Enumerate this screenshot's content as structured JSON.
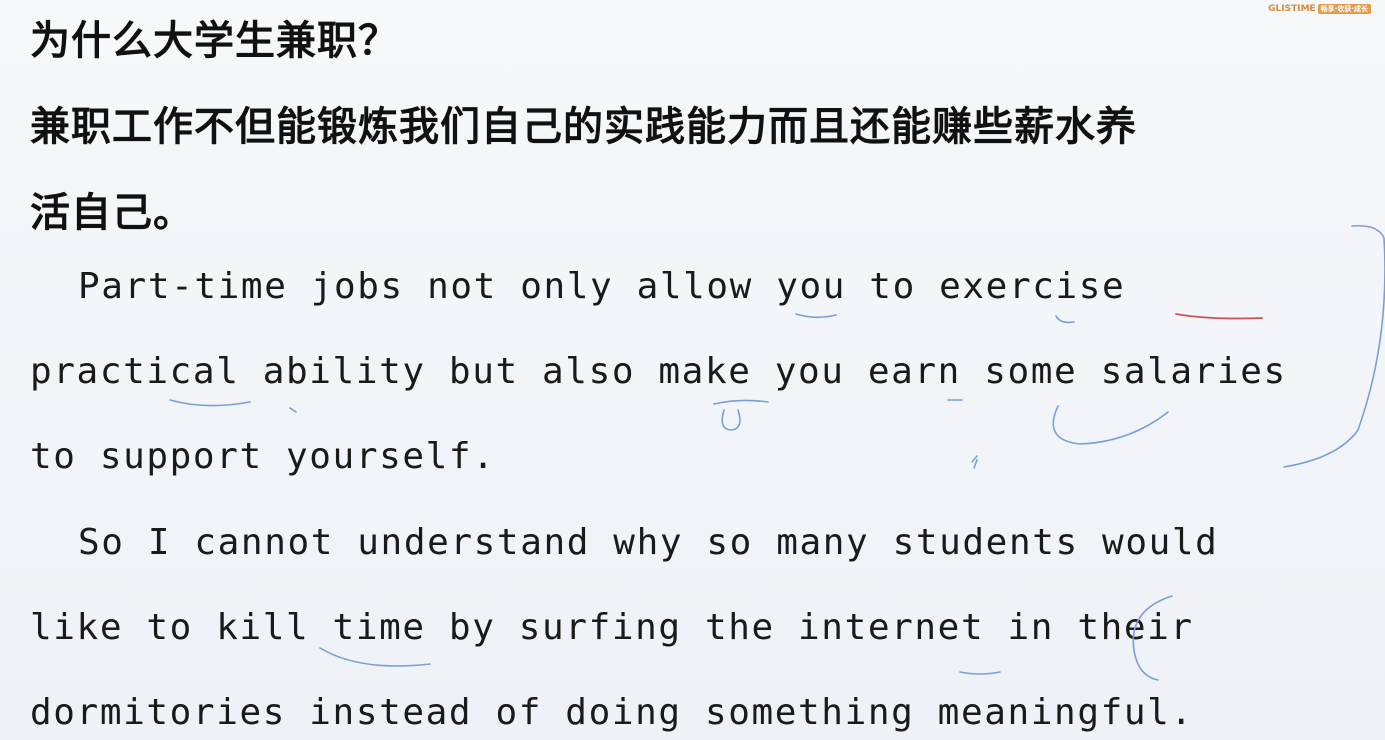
{
  "logo": {
    "brand": "GLISTIME",
    "tag": "畅享·收获·成长"
  },
  "heading": {
    "question": "为什么大学生兼职？",
    "answer_line1": "兼职工作不但能锻炼我们自己的实践能力而且还能赚些薪水养",
    "answer_line2": "活自己。"
  },
  "paragraph1": {
    "line1": "Part-time jobs not only allow you to exercise",
    "line2": "practical ability but also make you earn some salaries",
    "line3": "to support yourself."
  },
  "paragraph2": {
    "line1": "So I cannot understand why so many students would",
    "line2": "like to kill time by surfing the internet in their",
    "line3": "dormitories instead of doing something meaningful."
  },
  "annotation_colors": {
    "ink": "#7a9fd8",
    "red": "#d0505a"
  }
}
